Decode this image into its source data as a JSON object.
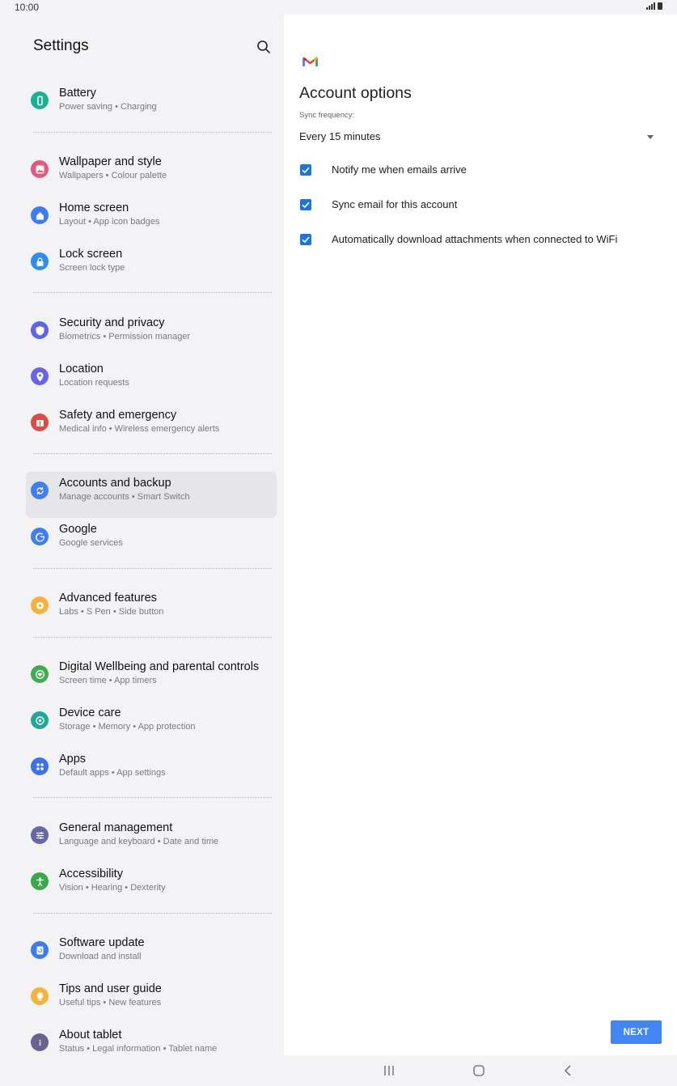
{
  "status": {
    "time": "10:00"
  },
  "settings": {
    "title": "Settings",
    "groups": [
      [
        {
          "title": "Battery",
          "subtitle": "Power saving  •  Charging",
          "icon": "battery-icon",
          "color": "#1bb090"
        }
      ],
      [
        {
          "title": "Wallpaper and style",
          "subtitle": "Wallpapers  •  Colour palette",
          "icon": "wallpaper-icon",
          "color": "#e8557e"
        },
        {
          "title": "Home screen",
          "subtitle": "Layout  •  App icon badges",
          "icon": "home-icon",
          "color": "#3d7bf2"
        },
        {
          "title": "Lock screen",
          "subtitle": "Screen lock type",
          "icon": "lock-icon",
          "color": "#2e8cf3"
        }
      ],
      [
        {
          "title": "Security and privacy",
          "subtitle": "Biometrics  •  Permission manager",
          "icon": "shield-icon",
          "color": "#5d64e8"
        },
        {
          "title": "Location",
          "subtitle": "Location requests",
          "icon": "location-pin-icon",
          "color": "#6b63e6"
        },
        {
          "title": "Safety and emergency",
          "subtitle": "Medical info  •  Wireless emergency alerts",
          "icon": "emergency-icon",
          "color": "#de4b43"
        }
      ],
      [
        {
          "title": "Accounts and backup",
          "subtitle": "Manage accounts  •  Smart Switch",
          "icon": "sync-icon",
          "color": "#3f7ef3",
          "selected": true
        },
        {
          "title": "Google",
          "subtitle": "Google services",
          "icon": "google-icon",
          "color": "#3f7ef3"
        }
      ],
      [
        {
          "title": "Advanced features",
          "subtitle": "Labs  •  S Pen  •  Side button",
          "icon": "star-gear-icon",
          "color": "#f5b23c"
        }
      ],
      [
        {
          "title": "Digital Wellbeing and parental controls",
          "subtitle": "Screen time  •  App timers",
          "icon": "wellbeing-icon",
          "color": "#3ead4f"
        },
        {
          "title": "Device care",
          "subtitle": "Storage  •  Memory  •  App protection",
          "icon": "device-care-icon",
          "color": "#20a896"
        },
        {
          "title": "Apps",
          "subtitle": "Default apps  •  App settings",
          "icon": "apps-grid-icon",
          "color": "#3d6ff0"
        }
      ],
      [
        {
          "title": "General management",
          "subtitle": "Language and keyboard  •  Date and time",
          "icon": "sliders-icon",
          "color": "#6767a6"
        },
        {
          "title": "Accessibility",
          "subtitle": "Vision  •  Hearing  •  Dexterity",
          "icon": "accessibility-icon",
          "color": "#3aa84a"
        }
      ],
      [
        {
          "title": "Software update",
          "subtitle": "Download and install",
          "icon": "software-update-icon",
          "color": "#3d7bf2"
        },
        {
          "title": "Tips and user guide",
          "subtitle": "Useful tips  •  New features",
          "icon": "lightbulb-icon",
          "color": "#f2b43a"
        },
        {
          "title": "About tablet",
          "subtitle": "Status  •  Legal information  •  Tablet name",
          "icon": "info-icon",
          "color": "#6a638f"
        }
      ]
    ]
  },
  "account_options": {
    "title": "Account options",
    "sync_label": "Sync frequency:",
    "sync_value": "Every 15 minutes",
    "options": [
      {
        "label": "Notify me when emails arrive",
        "checked": true
      },
      {
        "label": "Sync email for this account",
        "checked": true
      },
      {
        "label": "Automatically download attachments when connected to WiFi",
        "checked": true
      }
    ],
    "next_label": "NEXT"
  },
  "colors": {
    "accent": "#4285f4",
    "checkbox": "#1a73e8",
    "selected_bg": "#e6e6e9"
  }
}
